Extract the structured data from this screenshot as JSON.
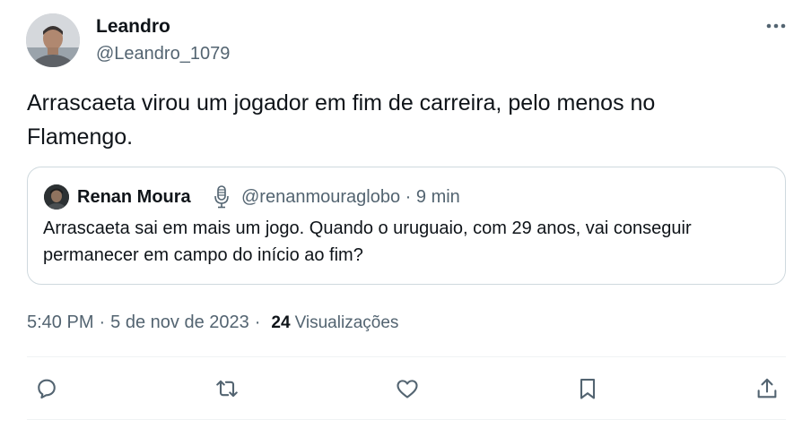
{
  "author": {
    "name": "Leandro",
    "handle": "@Leandro_1079"
  },
  "tweet": {
    "text": "Arrascaeta virou um jogador em fim de carreira, pelo menos no\nFlamengo."
  },
  "quoted_tweet": {
    "name": "Renan Moura",
    "handle": "@renanmouraglobo",
    "separator": "·",
    "time": "9 min",
    "text": "Arrascaeta sai em mais um jogo. Quando o uruguaio, com 29 anos, vai conseguir permanecer em campo do início ao fim?"
  },
  "meta": {
    "time": "5:40 PM",
    "date": "5 de nov de 2023",
    "separator": "·",
    "views_count": "24",
    "views_label": "Visualizações"
  },
  "icons": {
    "more": "more-horizontal-icon",
    "reply": "reply-icon",
    "retweet": "retweet-icon",
    "like": "like-icon",
    "bookmark": "bookmark-icon",
    "share": "share-icon",
    "podcast": "microphone-icon"
  },
  "colors": {
    "text_primary": "#0f1419",
    "text_secondary": "#536471",
    "border": "#cfd9de",
    "divider": "#eff3f4"
  }
}
